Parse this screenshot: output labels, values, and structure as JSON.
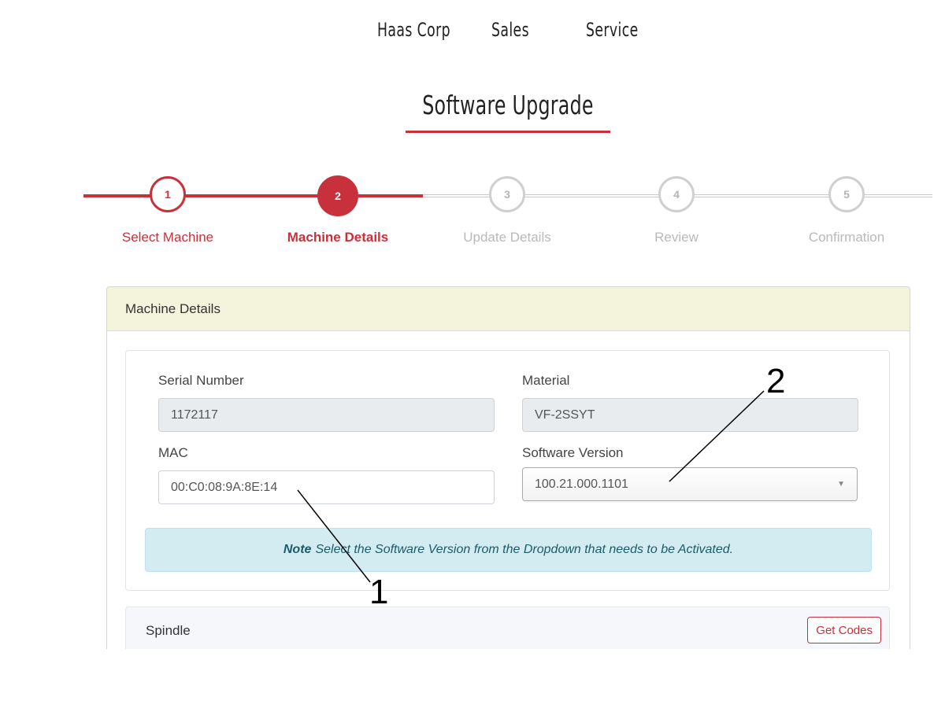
{
  "nav": {
    "links": [
      "Haas Corp",
      "Sales",
      "Service"
    ]
  },
  "page": {
    "title": "Software Upgrade"
  },
  "stepper": {
    "steps": [
      {
        "number": "1",
        "label": "Select Machine",
        "state": "done"
      },
      {
        "number": "2",
        "label": "Machine Details",
        "state": "active"
      },
      {
        "number": "3",
        "label": "Update Details",
        "state": "todo"
      },
      {
        "number": "4",
        "label": "Review",
        "state": "todo"
      },
      {
        "number": "5",
        "label": "Confirmation",
        "state": "todo"
      }
    ]
  },
  "panel": {
    "heading": "Machine Details",
    "serial_number": {
      "label": "Serial Number",
      "value": "1172117"
    },
    "material": {
      "label": "Material",
      "value": "VF-2SSYT"
    },
    "mac": {
      "label": "MAC",
      "value": "00:C0:08:9A:8E:14"
    },
    "software_version": {
      "label": "Software Version",
      "value": "100.21.000.1101"
    },
    "note": {
      "bold": "Note",
      "text": "Select the Software Version from the Dropdown that needs to be Activated."
    },
    "spindle": {
      "label": "Spindle",
      "button": "Get Codes"
    }
  },
  "callouts": {
    "one": "1",
    "two": "2"
  },
  "colors": {
    "accent": "#c8313b",
    "heading_bg": "#f4f3dc",
    "note_bg": "#d2ecf1"
  }
}
